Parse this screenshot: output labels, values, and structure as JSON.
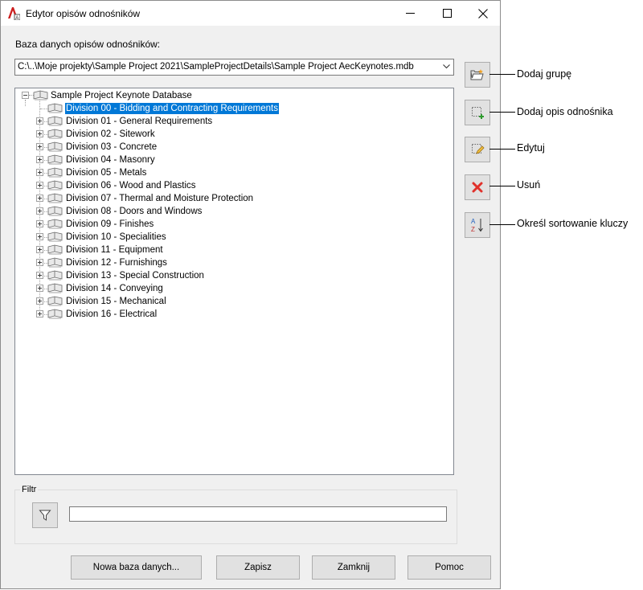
{
  "window": {
    "title": "Edytor opisów odnośników"
  },
  "database": {
    "label": "Baza danych opisów odnośników:",
    "path": "C:\\..\\Moje projekty\\Sample Project 2021\\SampleProjectDetails\\Sample Project AecKeynotes.mdb"
  },
  "tree": {
    "root": "Sample Project Keynote Database",
    "selected_index": 0,
    "items": [
      "Division 00 - Bidding and Contracting Requirements",
      "Division 01 - General Requirements",
      "Division 02 - Sitework",
      "Division 03 - Concrete",
      "Division 04 - Masonry",
      "Division 05 - Metals",
      "Division 06 - Wood and Plastics",
      "Division 07 - Thermal and Moisture Protection",
      "Division 08 - Doors and Windows",
      "Division 09 - Finishes",
      "Division 10 - Specialities",
      "Division 11 - Equipment",
      "Division 12 - Furnishings",
      "Division 13 - Special Construction",
      "Division 14 - Conveying",
      "Division 15 - Mechanical",
      "Division 16 - Electrical"
    ]
  },
  "side_actions": {
    "add_group": "Dodaj grupę",
    "add_keynote": "Dodaj opis odnośnika",
    "edit": "Edytuj",
    "delete": "Usuń",
    "sort": "Określ sortowanie kluczy"
  },
  "filter": {
    "legend": "Filtr",
    "value": ""
  },
  "buttons": {
    "new_db": "Nowa baza danych...",
    "save": "Zapisz",
    "close": "Zamknij",
    "help": "Pomoc"
  },
  "colors": {
    "selection": "#0078d7",
    "window_bg": "#f0f0f0",
    "delete_red": "#e0312b",
    "add_green": "#2e9b2e"
  }
}
